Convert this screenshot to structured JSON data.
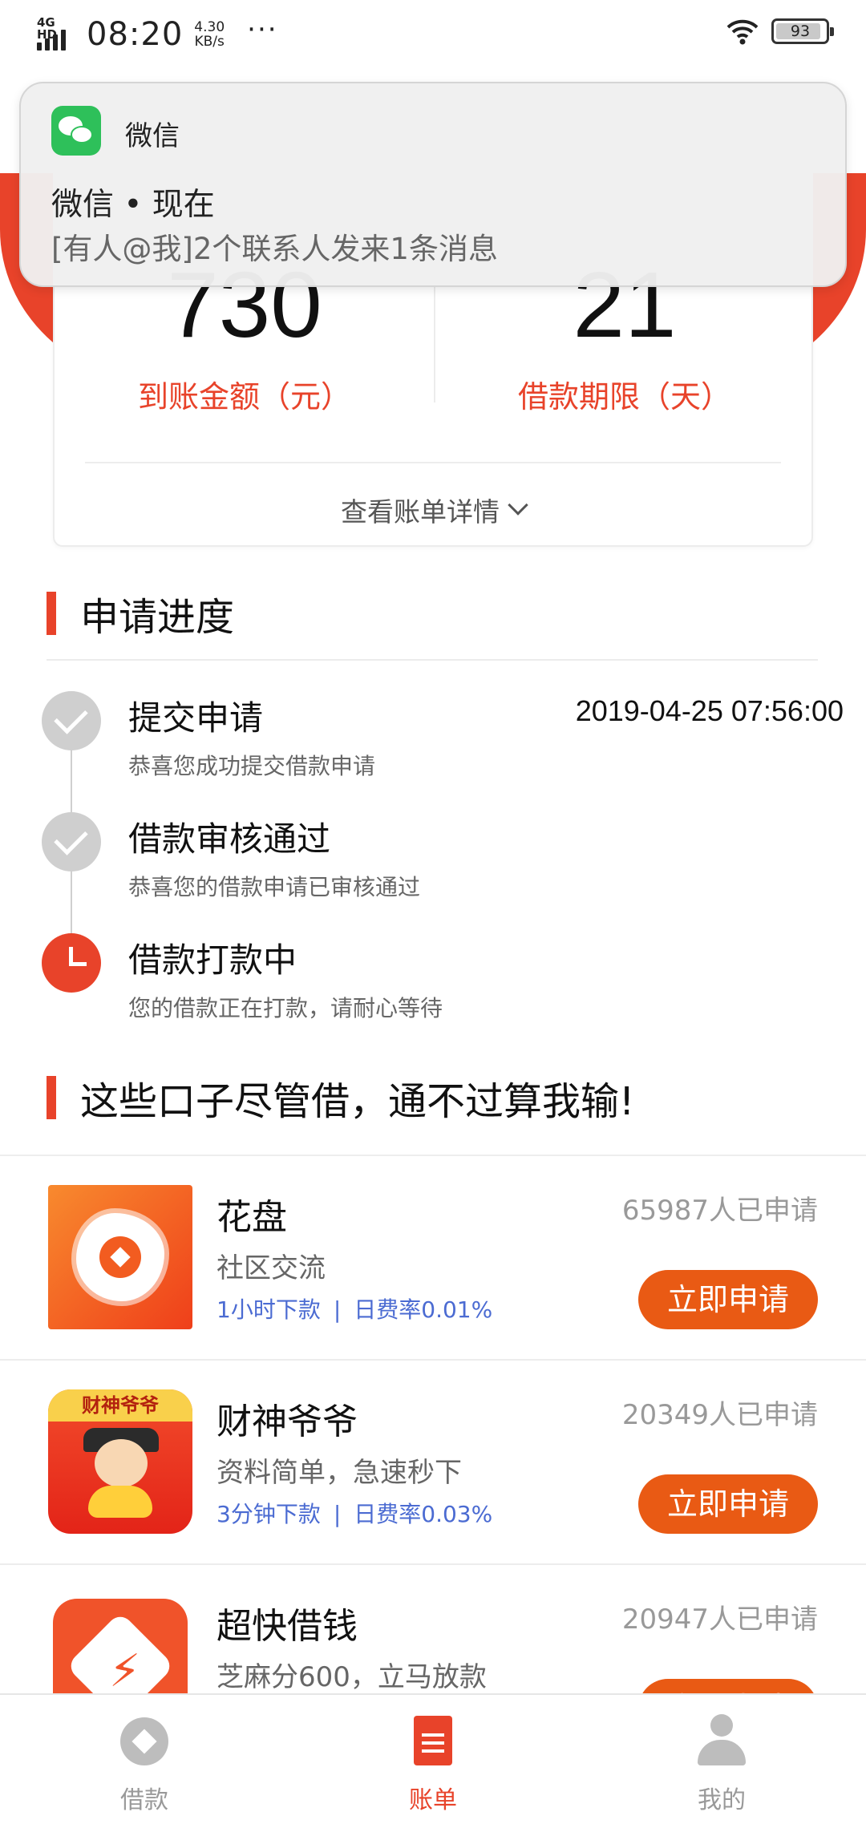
{
  "status_bar": {
    "network": "4G HD",
    "time": "08:20",
    "speed_value": "4.30",
    "speed_unit": "KB/s",
    "more": "···",
    "battery": "93"
  },
  "summary": {
    "amount_value": "730",
    "amount_label": "到账金额（元）",
    "term_value": "21",
    "term_label": "借款期限（天）",
    "detail_link": "查看账单详情"
  },
  "notification": {
    "app_name": "微信",
    "title": "微信 • 现在",
    "body": "[有人@我]2个联系人发来1条消息"
  },
  "progress": {
    "section_title": "申请进度",
    "steps": [
      {
        "title": "提交申请",
        "subtitle": "恭喜您成功提交借款申请",
        "time": "2019-04-25 07:56:00",
        "state": "done"
      },
      {
        "title": "借款审核通过",
        "subtitle": "恭喜您的借款申请已审核通过",
        "state": "done"
      },
      {
        "title": "借款打款中",
        "subtitle": "您的借款正在打款，请耐心等待",
        "state": "active"
      }
    ]
  },
  "recommend": {
    "section_title": "这些口子尽管借，通不过算我输!",
    "apply_label": "立即申请",
    "separator": "|",
    "items": [
      {
        "name": "花盘",
        "desc": "社区交流",
        "tag1": "1小时下款",
        "tag2": "日费率0.01%",
        "count": "65987人已申请"
      },
      {
        "name": "财神爷爷",
        "desc": "资料简单，急速秒下",
        "tag1": "3分钟下款",
        "tag2": "日费率0.03%",
        "count": "20349人已申请",
        "logo_text": "财神爷爷"
      },
      {
        "name": "超快借钱",
        "desc": "芝麻分600，立马放款",
        "count": "20947人已申请"
      }
    ]
  },
  "bottom_nav": {
    "items": [
      {
        "label": "借款",
        "icon": "loan-icon"
      },
      {
        "label": "账单",
        "icon": "bill-icon",
        "active": true
      },
      {
        "label": "我的",
        "icon": "profile-icon"
      }
    ]
  },
  "colors": {
    "brand_red": "#e8432a",
    "button_orange": "#e95a14",
    "tag_blue": "#4b6bd2",
    "wechat_green": "#2ec05a"
  }
}
